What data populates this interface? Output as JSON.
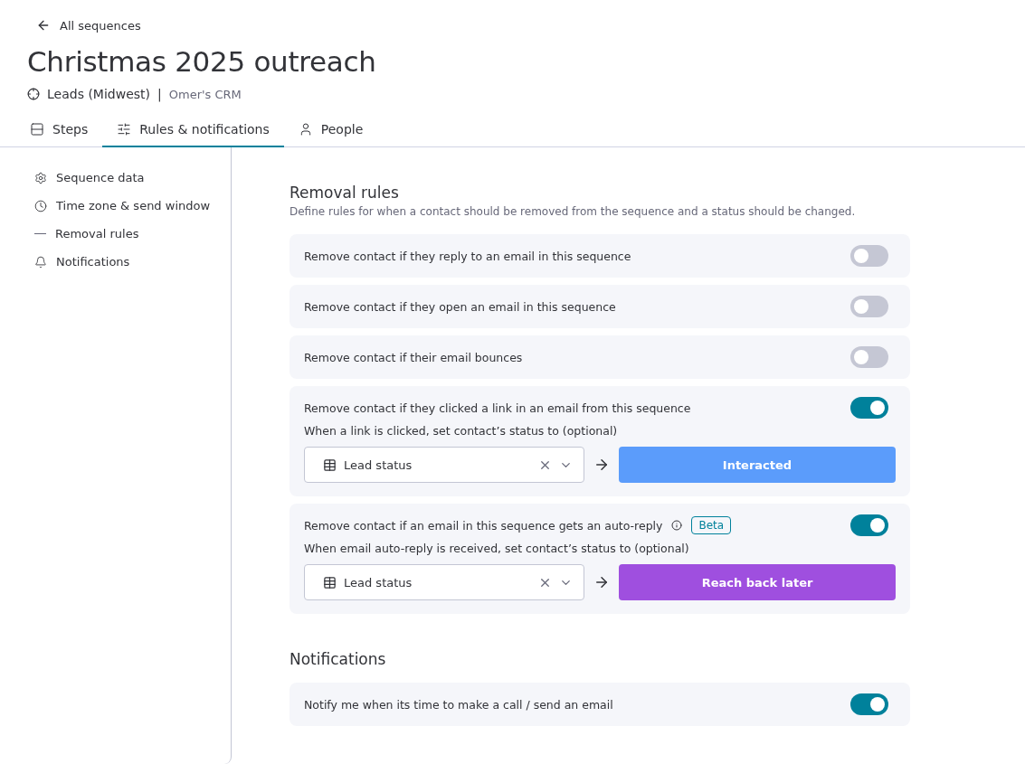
{
  "back_link": "All sequences",
  "title": "Christmas 2025 outreach",
  "subtitle": {
    "list": "Leads (Midwest)",
    "separator": "|",
    "crm": "Omer's CRM"
  },
  "tabs": [
    {
      "label": "Steps",
      "selected": false
    },
    {
      "label": "Rules & notifications",
      "selected": true
    },
    {
      "label": "People",
      "selected": false
    }
  ],
  "sidebar": {
    "items": [
      {
        "label": "Sequence data"
      },
      {
        "label": "Time zone & send window"
      },
      {
        "label": "Removal rules"
      },
      {
        "label": "Notifications"
      }
    ]
  },
  "removal_rules": {
    "heading": "Removal rules",
    "description": "Define rules for when a contact should be removed from the sequence and a status should be changed.",
    "rules": [
      {
        "kind": "toggle",
        "label": "Remove contact if they reply to an email in this sequence",
        "on": false
      },
      {
        "kind": "toggle",
        "label": "Remove contact if they open an email in this sequence",
        "on": false
      },
      {
        "kind": "toggle",
        "label": "Remove contact if their email bounces",
        "on": false
      },
      {
        "kind": "status",
        "label": "Remove contact if they clicked a link in an email from this sequence",
        "on": true,
        "prompt": "When a link is clicked, set contact’s status to (optional)",
        "field": "Lead status",
        "status": "Interacted",
        "color": "#5b9cfb"
      },
      {
        "kind": "status",
        "label": "Remove contact if an email in this sequence gets an auto-reply",
        "on": true,
        "badge": "Beta",
        "prompt": "When email auto-reply is received, set contact’s status to (optional)",
        "field": "Lead status",
        "status": "Reach back later",
        "color": "#9f4fdf"
      }
    ]
  },
  "notifications": {
    "heading": "Notifications",
    "rules": [
      {
        "kind": "toggle",
        "label": "Notify me when its time to make a call / send an email",
        "on": true
      }
    ]
  }
}
